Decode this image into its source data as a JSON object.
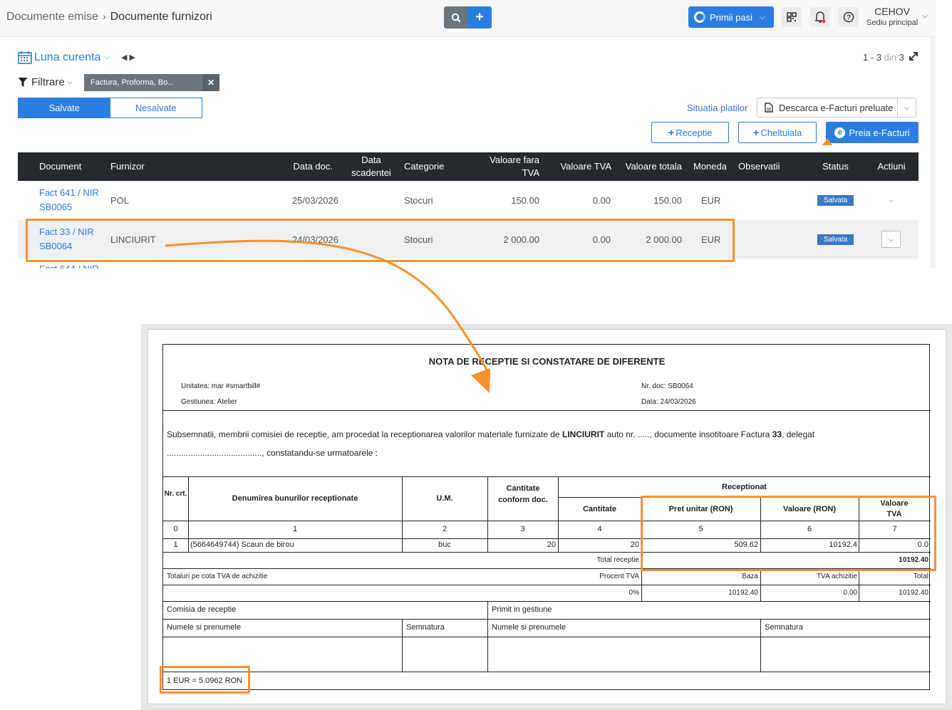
{
  "header": {
    "breadcrumb_parent": "Documente emise",
    "breadcrumb_current": "Documente furnizori",
    "primii_pasi": "Primii pasi",
    "user_name": "CEHOV",
    "user_location": "Sediu principal"
  },
  "toolbar": {
    "period": "Luna curenta",
    "pager_range": "1 - 3",
    "pager_din": "din",
    "pager_total": "3",
    "filter_label": "Filtrare",
    "filter_chip": "Factura, Proforma, Bo...",
    "toggle_saved": "Salvate",
    "toggle_unsaved": "Nesalvate",
    "situatia": "Situatia platilor",
    "descarca": "Descarca e-Facturi preluate",
    "btn_receptie": "Receptie",
    "btn_cheltuiala": "Cheltuiala",
    "btn_preia": "Preia e-Facturi"
  },
  "table": {
    "columns": [
      "Document",
      "Furnizor",
      "Data doc.",
      "Data scadentei",
      "Categorie",
      "Valoare fara TVA",
      "Valoare TVA",
      "Valoare totala",
      "Moneda",
      "Observatii",
      "Status",
      "Actiuni"
    ],
    "rows": [
      {
        "doc_line1": "Fact 641 / NIR",
        "doc_line2": "SB0065",
        "furnizor": "POL",
        "data_doc": "25/03/2026",
        "categorie": "Stocuri",
        "fara_tva": "150.00",
        "tva": "0.00",
        "total": "150.00",
        "moneda": "EUR",
        "status": "Salvata"
      },
      {
        "doc_line1": "Fact 33 / NIR",
        "doc_line2": "SB0064",
        "furnizor": "LINCIURIT",
        "data_doc": "24/03/2026",
        "categorie": "Stocuri",
        "fara_tva": "2 000.00",
        "tva": "0.00",
        "total": "2 000.00",
        "moneda": "EUR",
        "status": "Salvata"
      }
    ],
    "peek_row": "Fact 644 / NIR"
  },
  "nota": {
    "title": "NOTA DE RECEPTIE SI CONSTATARE DE DIFERENTE",
    "unitatea": "Unitatea: mar #smartbill#",
    "gestiunea": "Gestiunea: Atelier",
    "nr_doc": "Nr. doc: SB0064",
    "data": "Data: 24/03/2026",
    "intro_a": "Subsemnatii, membrii comisiei de receptie, am procedat la receptionarea valorilor materiale furnizate de ",
    "intro_furnizor": "LINCIURIT",
    "intro_b": " auto nr. ....., documente insotitoare Factura ",
    "intro_nr": "33",
    "intro_c": ", delegat",
    "intro_line2": "........................................, constatandu-se urmatoarele :",
    "col_nr": "Nr. crt.",
    "col_den": "Denumirea bunurilor receptionate",
    "col_um": "U.M.",
    "col_cant_doc": "Cantitate conform doc.",
    "col_receptionat": "Receptionat",
    "col_cantitate": "Cantitate",
    "col_pret": "Pret unitar (RON)",
    "col_valoare": "Valoare (RON)",
    "col_val_tva": "Valoare TVA",
    "idx": [
      "0",
      "1",
      "2",
      "3",
      "4",
      "5",
      "6",
      "7"
    ],
    "item": {
      "nr": "1",
      "den": "(5664649744) Scaun de birou",
      "um": "buc",
      "cant_doc": "20",
      "cant": "20",
      "pret": "509.62",
      "valoare": "10192.4",
      "tva": "0.0"
    },
    "total_label": "Total receptie",
    "total_value": "10192.40",
    "totaluri_label": "Totaluri pe cota TVA de achizitie",
    "procent_label": "Procent TVA",
    "baza_label": "Baza",
    "tva_ach_label": "TVA achizitie",
    "total_col_label": "Total",
    "procent": "0%",
    "baza": "10192.40",
    "tva_ach": "0.00",
    "total": "10192.40",
    "comisia": "Comisia de receptie",
    "primit": "Primit in gestiune",
    "nume1": "Numele si prenumele",
    "semnatura1": "Semnatura",
    "nume2": "Numele si prenumele",
    "semnatura2": "Semnatura",
    "curs": "1 EUR = 5.0962 RON"
  },
  "colors": {
    "accent": "#2a7de1",
    "highlight": "#f6922e",
    "header_bg": "#262a2e"
  },
  "icons": [
    "search-icon",
    "plus-icon",
    "qr-icon",
    "bell-icon",
    "help-icon",
    "calendar-icon",
    "filter-icon",
    "expand-icon",
    "file-icon",
    "e-factura-icon"
  ]
}
